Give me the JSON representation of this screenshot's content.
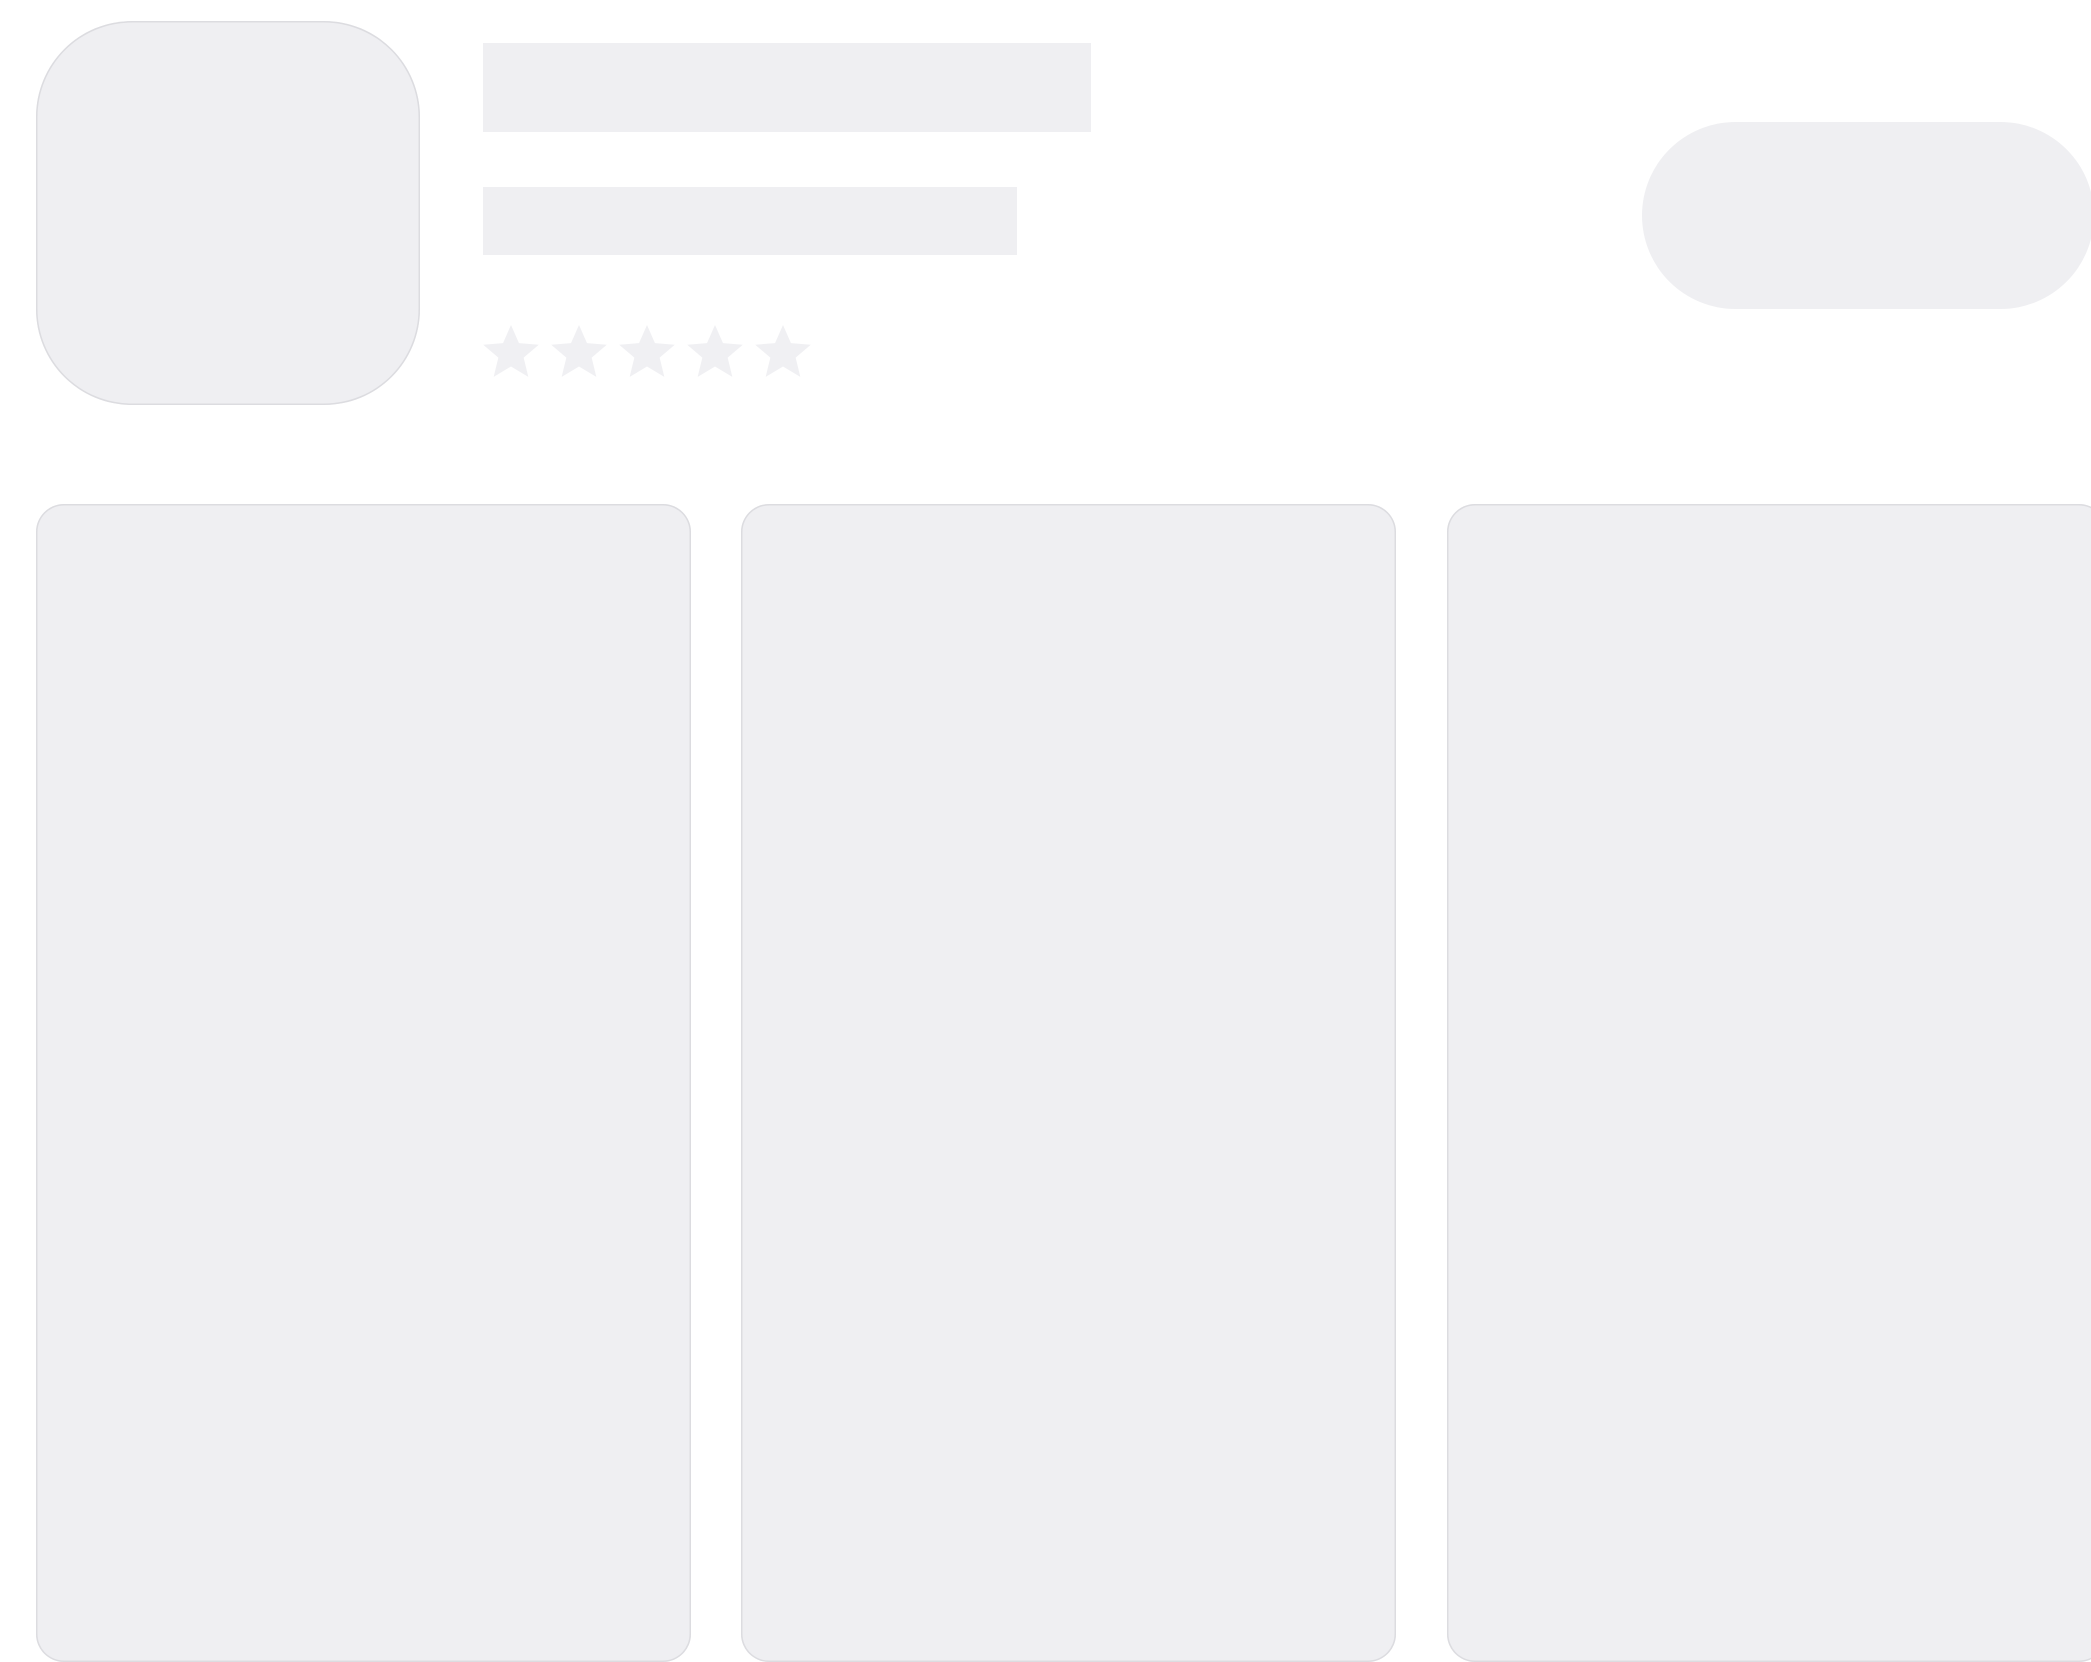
{
  "app_listing": {
    "state": "loading",
    "placeholder_color": "#efeff2",
    "outline_color": "#dcdce0",
    "icon": {
      "name": "app-icon-placeholder"
    },
    "rating": {
      "star_icon": "star-icon",
      "star_count": 5,
      "filled": 0
    },
    "actions": {
      "get_button": {
        "label": ""
      }
    },
    "screenshots": [
      {},
      {},
      {}
    ]
  }
}
